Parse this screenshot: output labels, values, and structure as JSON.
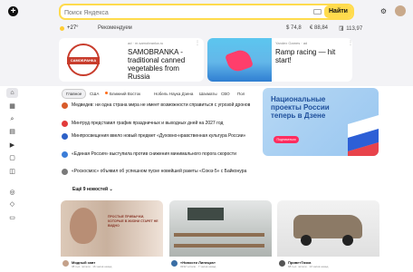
{
  "header": {
    "search_placeholder": "Поиск Яндекса",
    "search_button": "Найти"
  },
  "info_bar": {
    "temperature": "+27°",
    "region": "Рекомендуем",
    "rate_usd": "$ 74,8",
    "rate_eur": "€ 88,84",
    "rate_oil": "🛢 113,97"
  },
  "ads": [
    {
      "site": "ad · m.samobranka.ru",
      "text": "SAMOBRANKA - traditional canned vegetables from Russia",
      "logo_text": "САМОБРАНКА"
    },
    {
      "site": "Yandex Games · ad",
      "text": "Ramp racing — hit start!"
    }
  ],
  "news": {
    "tabs": [
      "Главное",
      "США",
      "Ближний Восток",
      "Нобель Наука Дзена",
      "Шахматы",
      "СВО",
      "Пол"
    ],
    "items": [
      "Медведев: ни одна страна мира не имеет возможности справиться с угрозой дронов",
      "Минтруд представил график праздничных и выходных дней на 2027 год",
      "Минпросвещения ввело новый предмет «Духовно-нравственная культура России»",
      "«Единая Россия» выступила против снижения минимального порога скорости",
      "«Роскосмос» объявил об успешном пуске новейшей ракеты «Союз-5» с Байконура"
    ],
    "more_label": "Ещё 9 новостей"
  },
  "promo": {
    "title": "Национальные проекты России теперь в Дзене",
    "button": "Подписаться"
  },
  "feed": [
    {
      "title": "Модный завт",
      "meta": "38 тыс. читали · 16 часов назад",
      "image_text": "ПРОСТЫЕ ПРИВЫЧКИ, КОТОРЫЕ В ЖИЗНИ СТАРЕТ НЕ ВИДНО"
    },
    {
      "title": "«Новости Липецка»",
      "meta": "3232 читали · 7 часов назад"
    },
    {
      "title": "ПриветТачка",
      "meta": "68 тыс. читали · 13 часов назад"
    }
  ],
  "colors": {
    "accent": "#ffdb4d",
    "promo_blue": "#1e4f9b",
    "promo_btn": "#ff2d5f"
  }
}
